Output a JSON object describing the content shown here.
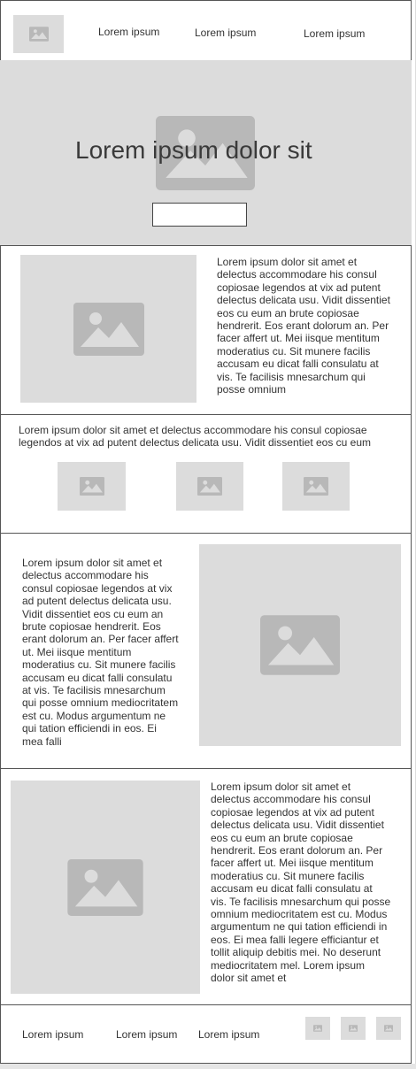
{
  "header": {
    "nav": [
      "Lorem ipsum",
      "Lorem ipsum",
      "Lorem ipsum"
    ]
  },
  "hero": {
    "title": "Lorem ipsum dolor sit",
    "button_label": ""
  },
  "section1": {
    "text": "Lorem ipsum dolor sit amet et delectus accommodare his consul copiosae legendos at vix ad putent delectus delicata usu. Vidit dissentiet eos cu eum an brute copiosae hendrerit. Eos erant dolorum an. Per facer affert ut. Mei iisque mentitum moderatius cu. Sit munere facilis accusam eu dicat falli consulatu at vis. Te facilisis mnesarchum qui posse omnium"
  },
  "section2": {
    "text": "Lorem ipsum dolor sit amet et delectus accommodare his consul copiosae legendos at vix ad putent delectus delicata usu. Vidit dissentiet eos cu eum"
  },
  "section3": {
    "text": "Lorem ipsum dolor sit amet et delectus accommodare his consul copiosae legendos at vix ad putent delectus delicata usu. Vidit dissentiet eos cu eum an brute copiosae hendrerit. Eos erant dolorum an. Per facer affert ut. Mei iisque mentitum moderatius cu. Sit munere facilis accusam eu dicat falli consulatu at vis. Te facilisis mnesarchum qui posse omnium mediocritatem est cu. Modus argumentum ne qui tation efficiendi in eos. Ei mea falli"
  },
  "section4": {
    "text": "Lorem ipsum dolor sit amet et delectus accommodare his consul copiosae legendos at vix ad putent delectus delicata usu. Vidit dissentiet eos cu eum an brute copiosae hendrerit. Eos erant dolorum an. Per facer affert ut. Mei iisque mentitum moderatius cu. Sit munere facilis accusam eu dicat falli consulatu at vis. Te facilisis mnesarchum qui posse omnium mediocritatem est cu. Modus argumentum ne qui tation efficiendi in eos. Ei mea falli legere efficiantur et tollit aliquip debitis mei. No deserunt mediocritatem mel. Lorem ipsum dolor sit amet et"
  },
  "footer": {
    "links": [
      "Lorem ipsum",
      "Lorem ipsum",
      "Lorem ipsum"
    ]
  },
  "icons": {
    "image_placeholder": "image-icon"
  },
  "colors": {
    "placeholder_bg": "#dcdcdc",
    "placeholder_icon": "#b8b8b8",
    "border": "#555555"
  }
}
